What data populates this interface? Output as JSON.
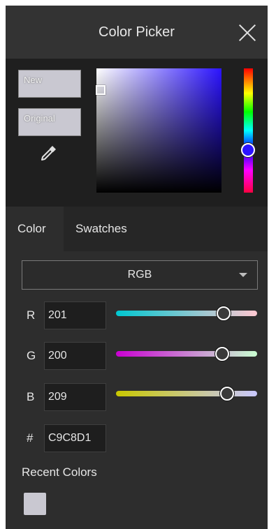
{
  "window": {
    "title": "Color Picker"
  },
  "preview": {
    "new_label": "New",
    "original_label": "Original",
    "current_color": "#C9C8D1"
  },
  "tabs": [
    {
      "label": "Color"
    },
    {
      "label": "Swatches"
    }
  ],
  "active_tab": "Color",
  "mode": {
    "selected": "RGB"
  },
  "channels": [
    {
      "label": "R",
      "value": "201"
    },
    {
      "label": "G",
      "value": "200"
    },
    {
      "label": "B",
      "value": "209"
    }
  ],
  "hex": {
    "label": "#",
    "value": "C9C8D1"
  },
  "recent": {
    "title": "Recent Colors",
    "colors": [
      "#C9C8D1"
    ]
  },
  "hue_color": "#2B13FF"
}
